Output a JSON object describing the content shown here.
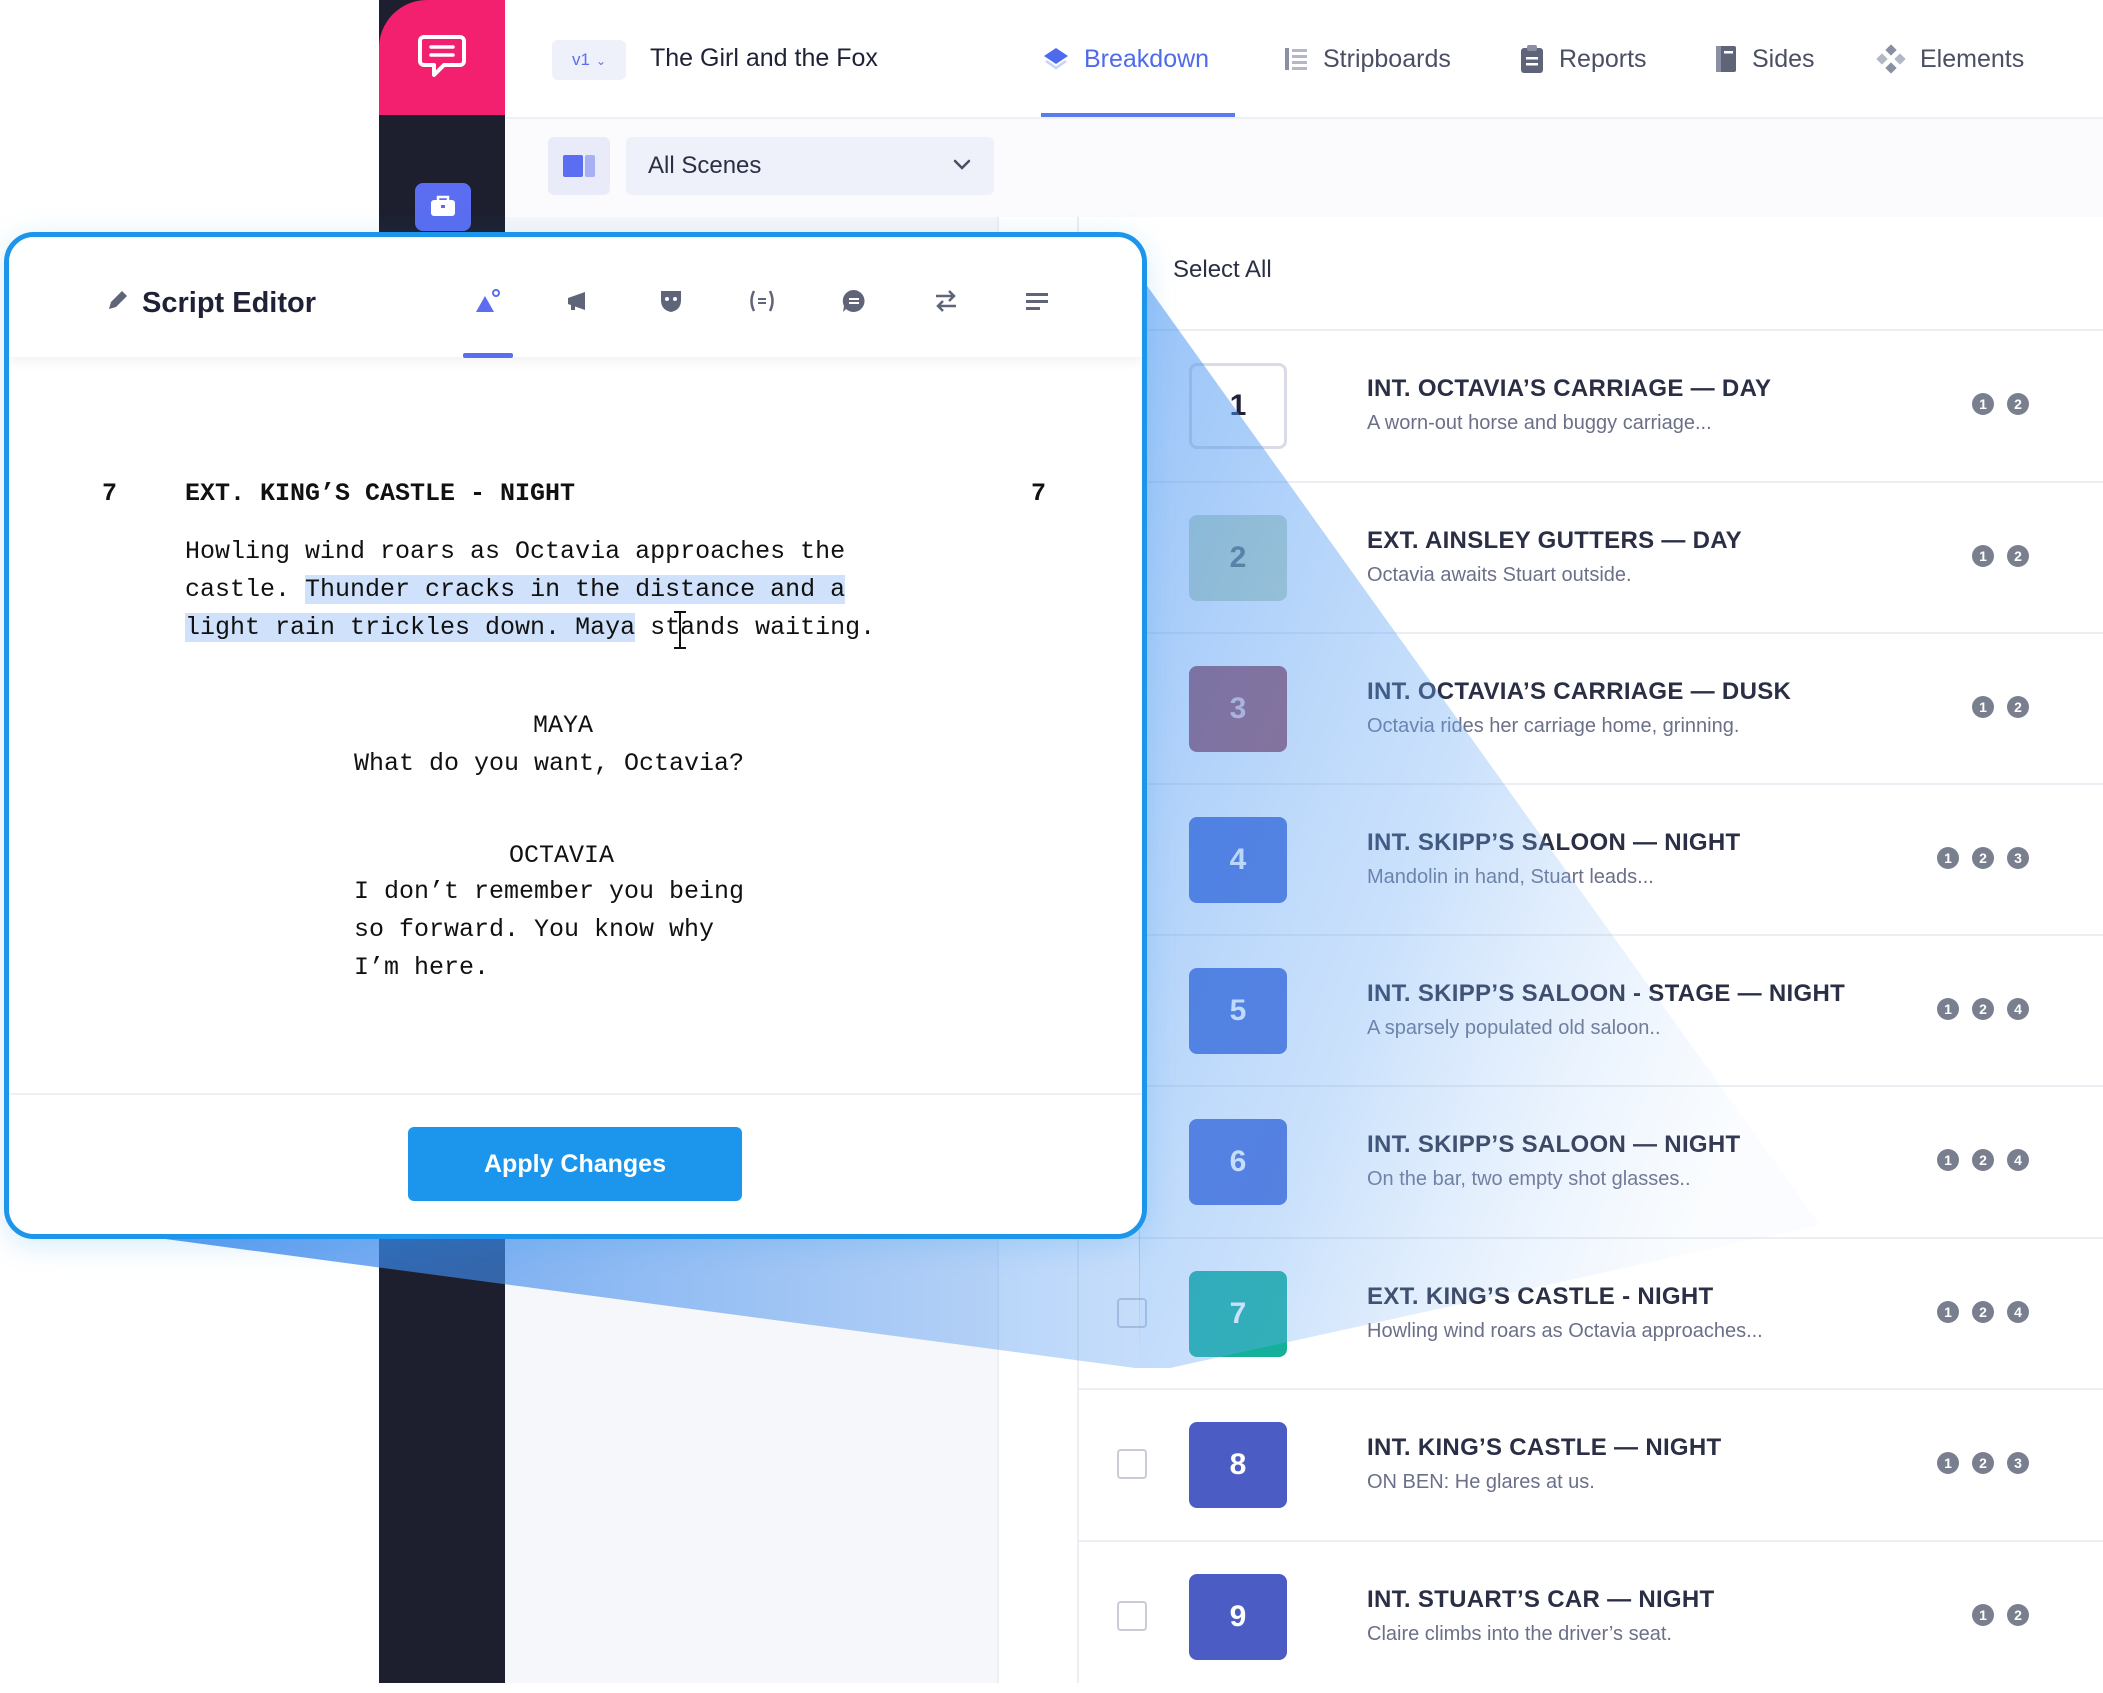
{
  "header": {
    "version": "v1",
    "project_title": "The Girl and the Fox",
    "tabs": [
      {
        "label": "Breakdown",
        "icon": "layers-icon",
        "active": true
      },
      {
        "label": "Stripboards",
        "icon": "stripboard-icon"
      },
      {
        "label": "Reports",
        "icon": "clipboard-icon"
      },
      {
        "label": "Sides",
        "icon": "notebook-icon"
      },
      {
        "label": "Elements",
        "icon": "elements-icon"
      }
    ]
  },
  "filter": {
    "scenes_value": "All Scenes"
  },
  "list": {
    "select_all_label": "Select All",
    "scenes": [
      {
        "number": "1",
        "slug": "INT.  OCTAVIA’S CARRIAGE — DAY",
        "description": "A worn-out horse and buggy carriage...",
        "badges": [
          "1",
          "2"
        ],
        "color": "#ffffff"
      },
      {
        "number": "2",
        "slug": "EXT.  AINSLEY GUTTERS — DAY",
        "description": "Octavia awaits Stuart outside.",
        "badges": [
          "1",
          "2"
        ],
        "color": "#c7d9c0"
      },
      {
        "number": "3",
        "slug": "INT.  OCTAVIA’S CARRIAGE — DUSK",
        "description": "Octavia rides her carriage home, grinning.",
        "badges": [
          "1",
          "2"
        ],
        "color": "#a0515f"
      },
      {
        "number": "4",
        "slug": "INT.  SKIPP’S SALOON — NIGHT",
        "description": "Mandolin in hand, Stuart leads...",
        "badges": [
          "1",
          "2",
          "3"
        ],
        "color": "#4a6bd6"
      },
      {
        "number": "5",
        "slug": "INT.  SKIPP’S SALOON - STAGE — NIGHT",
        "description": "A sparsely populated old saloon..",
        "badges": [
          "1",
          "2",
          "4"
        ],
        "color": "#4a6bd6"
      },
      {
        "number": "6",
        "slug": "INT.  SKIPP’S SALOON — NIGHT",
        "description": "On the bar, two empty shot glasses..",
        "badges": [
          "1",
          "2",
          "4"
        ],
        "color": "#4a6bd6"
      },
      {
        "number": "7",
        "slug": "EXT. KING’S CASTLE - NIGHT",
        "description": "Howling wind roars as Octavia approaches...",
        "badges": [
          "1",
          "2",
          "4"
        ],
        "color": "#14b09a"
      },
      {
        "number": "8",
        "slug": "INT.  KING’S CASTLE — NIGHT",
        "description": "ON BEN: He glares at us.",
        "badges": [
          "1",
          "2",
          "3"
        ],
        "color": "#4b5cc4"
      },
      {
        "number": "9",
        "slug": "INT.  STUART’S CAR — NIGHT",
        "description": "Claire climbs into the driver’s seat.",
        "badges": [
          "1",
          "2"
        ],
        "color": "#4b5cc4"
      }
    ]
  },
  "editor": {
    "title": "Script Editor",
    "tools": [
      "scene-icon",
      "megaphone-icon",
      "mask-icon",
      "parenthetical-icon",
      "dialogue-icon",
      "transition-icon",
      "text-align-icon"
    ],
    "scene_number_left": "7",
    "scene_number_right": "7",
    "scene_heading": "EXT. KING’S CASTLE - NIGHT",
    "action_line1": "Howling wind roars as Octavia approaches the",
    "action_line2_plain": "castle. ",
    "action_line2_highlight": "Thunder cracks in the distance and a",
    "action_line3_highlight": "light rain trickles down. Maya",
    "action_line3_plain": " stands waiting.",
    "character1": "MAYA",
    "dialogue1": "What do you want, Octavia?",
    "character2": "OCTAVIA",
    "dialogue2_lines": [
      "I don’t remember you being",
      "so forward. You know why",
      "I’m here."
    ],
    "apply_label": "Apply Changes"
  },
  "colors": {
    "accent": "#5b6df0",
    "brand": "#f2206e",
    "editor_border": "#1b96ec",
    "rail": "#1d1f2e"
  }
}
